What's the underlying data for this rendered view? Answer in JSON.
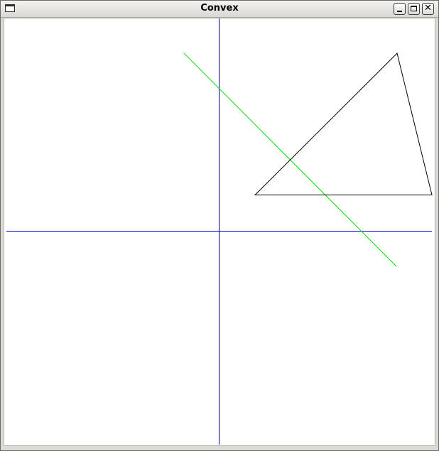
{
  "window": {
    "title": "Convex",
    "controls": {
      "minimize_icon": "minimize-icon",
      "maximize_icon": "maximize-icon",
      "close_glyph": "✕"
    }
  },
  "canvas": {
    "background": "#ffffff",
    "axes": {
      "x_axis_color": "#0000cc",
      "y_axis_color": "#000088"
    },
    "separating_line_color": "#00dd00",
    "triangle_color": "#000000"
  }
}
